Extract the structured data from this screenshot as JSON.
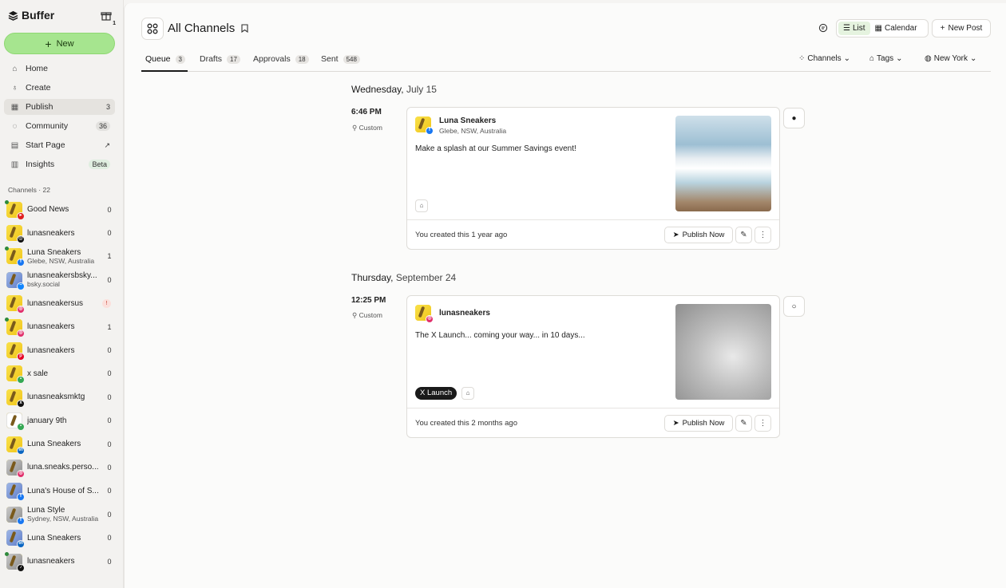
{
  "brand": {
    "name": "Buffer",
    "gift_count": "1"
  },
  "sidebar": {
    "new_label": "New",
    "nav": [
      {
        "label": "Home",
        "count": ""
      },
      {
        "label": "Create",
        "count": ""
      },
      {
        "label": "Publish",
        "count": "3"
      },
      {
        "label": "Community",
        "count": "36"
      },
      {
        "label": "Start Page",
        "count": ""
      },
      {
        "label": "Insights",
        "count": "Beta"
      }
    ],
    "channels_header": "Channels · 22",
    "channels": [
      {
        "name": "Good News",
        "sub": "",
        "count": "0",
        "network": "youtube"
      },
      {
        "name": "lunasneakers",
        "sub": "",
        "count": "0",
        "network": "threads"
      },
      {
        "name": "Luna Sneakers",
        "sub": "Glebe, NSW, Australia",
        "count": "1",
        "network": "facebook"
      },
      {
        "name": "lunasneakersbsky...",
        "sub": "bsky.social",
        "count": "0",
        "network": "bluesky"
      },
      {
        "name": "lunasneakersus",
        "sub": "",
        "count": "",
        "network": "instagram"
      },
      {
        "name": "lunasneakers",
        "sub": "",
        "count": "1",
        "network": "instagram"
      },
      {
        "name": "lunasneakers",
        "sub": "",
        "count": "0",
        "network": "pinterest"
      },
      {
        "name": "x sale",
        "sub": "",
        "count": "0",
        "network": "google-business"
      },
      {
        "name": "lunasneaksmktg",
        "sub": "",
        "count": "0",
        "network": "x"
      },
      {
        "name": "january 9th",
        "sub": "",
        "count": "0",
        "network": "google-business"
      },
      {
        "name": "Luna Sneakers",
        "sub": "",
        "count": "0",
        "network": "linkedin"
      },
      {
        "name": "luna.sneaks.perso...",
        "sub": "",
        "count": "0",
        "network": "instagram"
      },
      {
        "name": "Luna's House of S...",
        "sub": "",
        "count": "0",
        "network": "facebook"
      },
      {
        "name": "Luna Style",
        "sub": "Sydney, NSW, Australia",
        "count": "0",
        "network": "facebook"
      },
      {
        "name": "Luna Sneakers",
        "sub": "",
        "count": "0",
        "network": "linkedin"
      },
      {
        "name": "lunasneakers",
        "sub": "",
        "count": "0",
        "network": "tiktok"
      }
    ]
  },
  "header": {
    "title": "All Channels",
    "view_list": "List",
    "view_calendar": "Calendar",
    "new_post": "New Post"
  },
  "tabs": [
    {
      "label": "Queue",
      "count": "3"
    },
    {
      "label": "Drafts",
      "count": "17"
    },
    {
      "label": "Approvals",
      "count": "18"
    },
    {
      "label": "Sent",
      "count": "548"
    }
  ],
  "filters": {
    "channels": "Channels",
    "tags": "Tags",
    "timezone": "New York"
  },
  "posts": [
    {
      "day": "Wednesday,",
      "date": "July 15",
      "time": "6:46 PM",
      "schedule": "Custom",
      "channel": "Luna Sneakers",
      "location": "Glebe, NSW, Australia",
      "text": "Make a splash at our Summer Savings event!",
      "tag": "",
      "created": "You created this 1 year ago",
      "publish_label": "Publish Now"
    },
    {
      "day": "Thursday,",
      "date": "September 24",
      "time": "12:25 PM",
      "schedule": "Custom",
      "channel": "lunasneakers",
      "location": "",
      "text": "The X Launch... coming your way... in 10 days...",
      "tag": "X Launch",
      "created": "You created this 2 months ago",
      "publish_label": "Publish Now"
    }
  ],
  "colors": {
    "accent": "#a6e58f",
    "instagram": "#e1306c",
    "facebook": "#1877f2"
  }
}
